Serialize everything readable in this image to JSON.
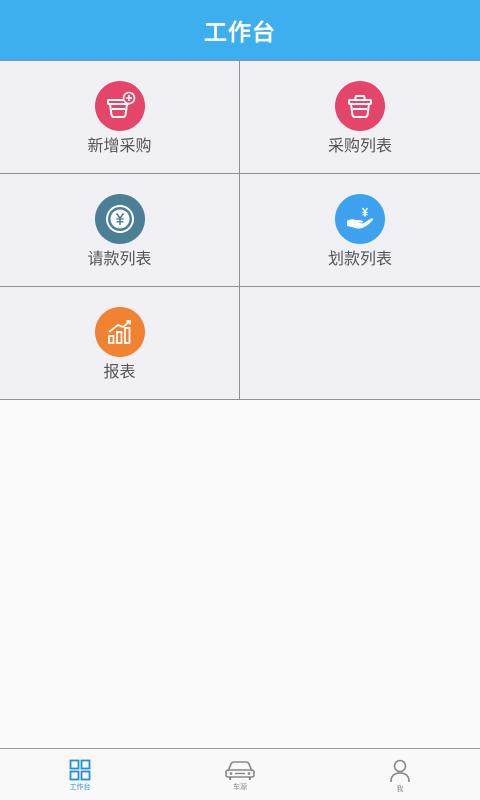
{
  "header": {
    "title": "工作台"
  },
  "menu": [
    {
      "label": "新增采购",
      "icon": "basket-add-icon",
      "color": "#e6456a"
    },
    {
      "label": "采购列表",
      "icon": "basket-icon",
      "color": "#e6456a"
    },
    {
      "label": "请款列表",
      "icon": "yuan-coin-icon",
      "color": "#4a7f96"
    },
    {
      "label": "划款列表",
      "icon": "hand-yuan-icon",
      "color": "#3ea2f0"
    },
    {
      "label": "报表",
      "icon": "bar-chart-icon",
      "color": "#f08232"
    }
  ],
  "tabbar": {
    "active_color": "#1f8fd8",
    "items": [
      {
        "label": "工作台",
        "icon": "grid-icon",
        "active": true
      },
      {
        "label": "车源",
        "icon": "car-icon",
        "active": false
      },
      {
        "label": "我",
        "icon": "user-icon",
        "active": false
      }
    ]
  }
}
